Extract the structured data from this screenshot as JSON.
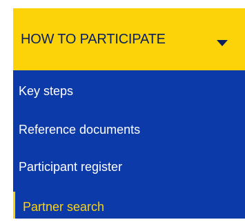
{
  "menu": {
    "header_label": "HOW TO PARTICIPATE",
    "items": [
      {
        "label": "Key steps"
      },
      {
        "label": "Reference documents"
      },
      {
        "label": "Participant register"
      },
      {
        "label": "Partner search"
      }
    ],
    "active_index": 3
  },
  "colors": {
    "header_bg": "#fcd308",
    "header_text": "#0a1f5c",
    "list_bg": "#0d3aa9",
    "item_text": "#ffffff",
    "active_text": "#fcd308"
  },
  "icons": {
    "header_toggle": "caret-down-icon"
  }
}
